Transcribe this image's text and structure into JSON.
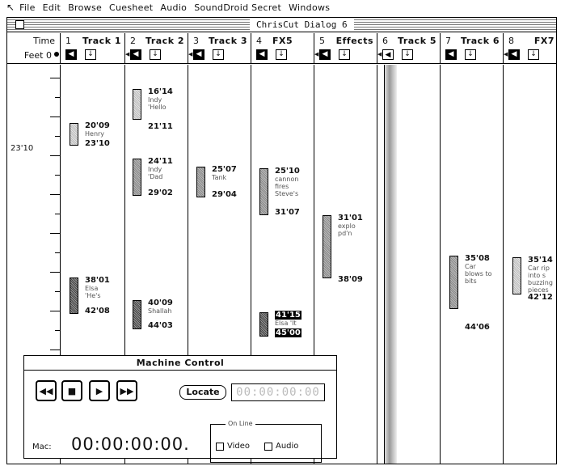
{
  "menubar": {
    "items": [
      "File",
      "Edit",
      "Browse",
      "Cuesheet",
      "Audio",
      "SoundDroid Secret",
      "Windows"
    ]
  },
  "window": {
    "title": "ChrisCut Dialog 6"
  },
  "header": {
    "time_label": "Time",
    "feet_label": "Feet",
    "feet_value": "0",
    "tracks": [
      {
        "num": "1",
        "name": "Track 1"
      },
      {
        "num": "2",
        "name": "Track 2"
      },
      {
        "num": "3",
        "name": "Track 3"
      },
      {
        "num": "4",
        "name": "FX5"
      },
      {
        "num": "5",
        "name": "Effects"
      },
      {
        "num": "6",
        "name": "Track 5"
      },
      {
        "num": "7",
        "name": "Track 6"
      },
      {
        "num": "8",
        "name": "FX7"
      }
    ]
  },
  "timeline": {
    "time_marker": "23'10"
  },
  "clips": [
    {
      "in": "20'09",
      "desc": "Henry",
      "out": "23'10"
    },
    {
      "in": "38'01",
      "desc": "Elsa\n'He's",
      "out": "42'08"
    },
    {
      "in": "16'14",
      "desc": "Indy\n'Hello",
      "out": "21'11"
    },
    {
      "in": "24'11",
      "desc": "Indy\n'Dad",
      "out": "29'02"
    },
    {
      "in": "40'09",
      "desc": "Shallah",
      "out": "44'03"
    },
    {
      "in": "25'07",
      "desc": "Tank",
      "out": "29'04"
    },
    {
      "in": "25'10",
      "desc": "cannon\nfires\nSteve's",
      "out": "31'07"
    },
    {
      "in": "41'15",
      "desc": "Elsa 'It",
      "out": "45'00"
    },
    {
      "in": "31'01",
      "desc": "explo\npd'n",
      "out": "38'09"
    },
    {
      "in": "35'08",
      "desc": "Car\nblows to\nbits",
      "out": "44'06"
    },
    {
      "in": "35'14",
      "desc": "Car rip\ninto s\nbuzzing\npieces",
      "out": "42'12"
    }
  ],
  "machine_control": {
    "title": "Machine Control",
    "locate_label": "Locate",
    "locate_value": "00:00:00:00",
    "mac_label": "Mac:",
    "mac_time": "00:00:00:00.",
    "online_label": "On Line",
    "video_label": "Video",
    "audio_label": "Audio"
  }
}
